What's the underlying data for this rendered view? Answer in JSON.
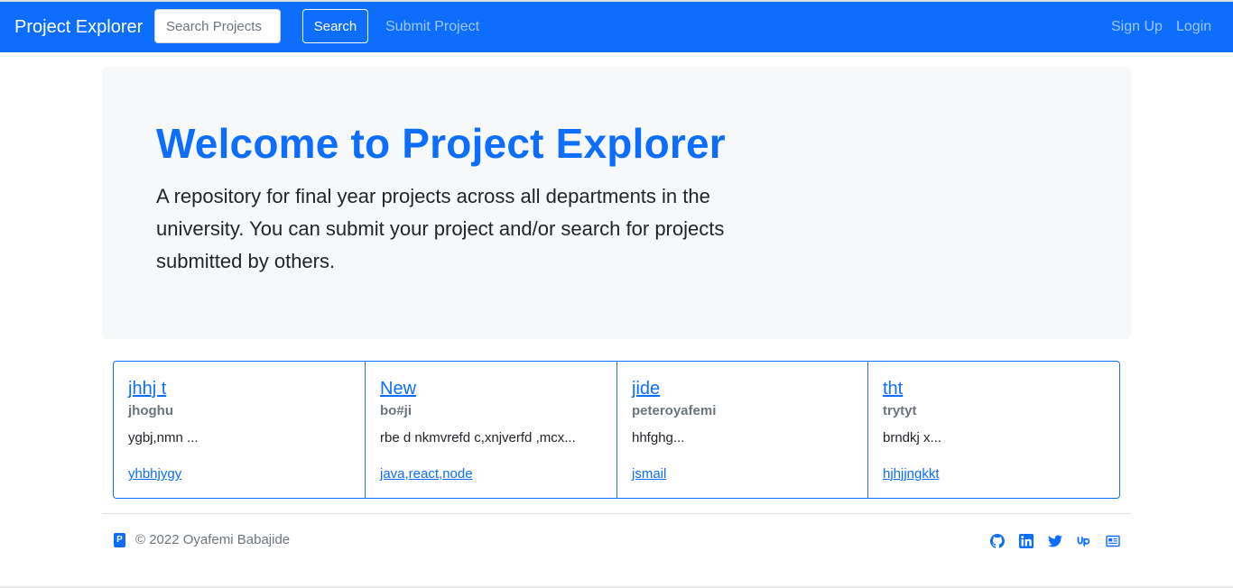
{
  "navbar": {
    "brand": "Project Explorer",
    "search_placeholder": "Search Projects",
    "search_button": "Search",
    "links": [
      "Submit Project",
      "Sign Up",
      "Login"
    ]
  },
  "hero": {
    "title": "Welcome to Project Explorer",
    "lead": "A repository for final year projects across all departments in the university. You can submit your project and/or search for projects submitted by others."
  },
  "projects": [
    {
      "title": "jhhj t",
      "author": "jhoghu",
      "abstract": "ygbj,nmn ...",
      "tags": "yhbhjygy"
    },
    {
      "title": "New",
      "author": "bo#ji",
      "abstract": "rbe d nkmvrefd c,xnjverfd ,mcx...",
      "tags": "java,react,node"
    },
    {
      "title": "jide",
      "author": "peteroyafemi",
      "abstract": "hhfghg...",
      "tags": "jsmail"
    },
    {
      "title": "tht",
      "author": "trytyt",
      "abstract": "brndkj x...",
      "tags": "hjhjjngkkt"
    }
  ],
  "footer": {
    "logo_letter": "P",
    "copyright": "© 2022 Oyafemi Babajide",
    "social_icons": [
      "github-icon",
      "linkedin-icon",
      "twitter-icon",
      "upwork-icon",
      "portfolio-icon"
    ]
  },
  "colors": {
    "primary": "#0d6efd",
    "jumbotron_bg": "#f7f8f9",
    "muted": "#6c757d"
  }
}
